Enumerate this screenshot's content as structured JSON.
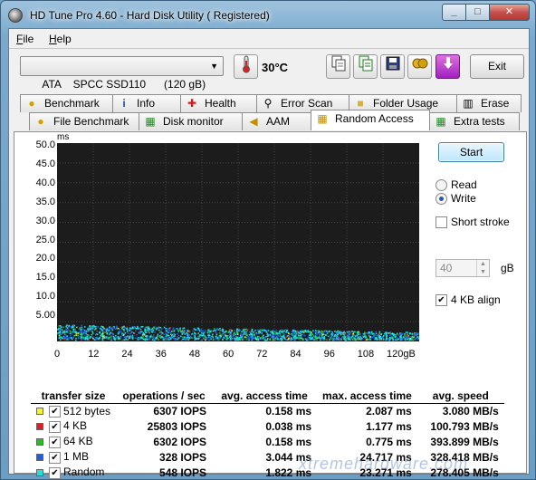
{
  "window": {
    "title": "HD Tune Pro 4.60 - Hard Disk Utility ( Registered)",
    "controls": {
      "minimize": "_",
      "maximize": "□",
      "close": "✕"
    }
  },
  "menu": {
    "file": "File",
    "help": "Help"
  },
  "toolbar": {
    "drive": "ATA    SPCC SSD110      (120 gB)",
    "temperature": "30°C",
    "exit": "Exit",
    "icons": [
      "thermometer-icon",
      "copy-icon",
      "copy-all-icon",
      "save-icon",
      "screenshot-icon",
      "download-icon"
    ]
  },
  "tabs": {
    "row1": [
      {
        "label": "Benchmark",
        "icon": "💡"
      },
      {
        "label": "Info",
        "icon": "ℹ"
      },
      {
        "label": "Health",
        "icon": "✚"
      },
      {
        "label": "Error Scan",
        "icon": "🔍"
      },
      {
        "label": "Folder Usage",
        "icon": "📁"
      },
      {
        "label": "Erase",
        "icon": "🗑"
      }
    ],
    "row2": [
      {
        "label": "File Benchmark",
        "icon": "💡"
      },
      {
        "label": "Disk monitor",
        "icon": "▦"
      },
      {
        "label": "AAM",
        "icon": "🔊"
      },
      {
        "label": "Random Access",
        "icon": "▦"
      },
      {
        "label": "Extra tests",
        "icon": "▦"
      }
    ]
  },
  "graph": {
    "unit": "ms",
    "y_ticks": [
      "50.0",
      "45.0",
      "40.0",
      "35.0",
      "30.0",
      "25.0",
      "20.0",
      "15.0",
      "10.0",
      "5.00"
    ],
    "x_ticks": [
      "0",
      "12",
      "24",
      "36",
      "48",
      "60",
      "72",
      "84",
      "96",
      "108",
      "120gB"
    ]
  },
  "controls": {
    "start": "Start",
    "read": "Read",
    "write": "Write",
    "mode_selected": "write",
    "short_stroke": "Short stroke",
    "short_stroke_checked": false,
    "stroke_value": "40",
    "stroke_unit": "gB",
    "align": "4 KB align",
    "align_checked": true
  },
  "stats": {
    "headers": [
      "transfer size",
      "operations / sec",
      "avg. access time",
      "max. access time",
      "avg. speed"
    ],
    "rows": [
      {
        "color": "#f5f520",
        "size": "512 bytes",
        "ops": "6307 IOPS",
        "avg": "0.158 ms",
        "max": "2.087 ms",
        "speed": "3.080 MB/s"
      },
      {
        "color": "#e02020",
        "size": "4 KB",
        "ops": "25803 IOPS",
        "avg": "0.038 ms",
        "max": "1.177 ms",
        "speed": "100.793 MB/s"
      },
      {
        "color": "#20c020",
        "size": "64 KB",
        "ops": "6302 IOPS",
        "avg": "0.158 ms",
        "max": "0.775 ms",
        "speed": "393.899 MB/s"
      },
      {
        "color": "#2060e0",
        "size": "1 MB",
        "ops": "328 IOPS",
        "avg": "3.044 ms",
        "max": "24.717 ms",
        "speed": "328.418 MB/s"
      },
      {
        "color": "#20e0e0",
        "size": "Random",
        "ops": "548 IOPS",
        "avg": "1.822 ms",
        "max": "23.271 ms",
        "speed": "278.405 MB/s"
      }
    ]
  },
  "watermark": "xtremehardware.com"
}
